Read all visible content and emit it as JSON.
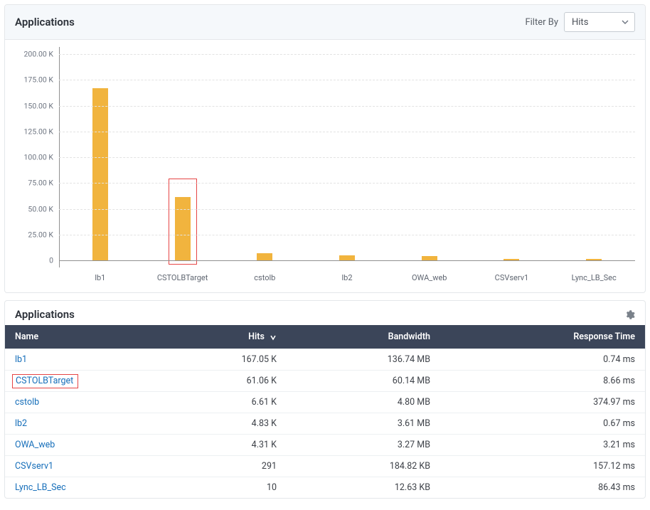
{
  "chart_panel": {
    "title": "Applications",
    "filter_label": "Filter By",
    "filter_value": "Hits"
  },
  "chart_data": {
    "type": "bar",
    "title": "",
    "xlabel": "",
    "ylabel": "",
    "categories": [
      "lb1",
      "CSTOLBTarget",
      "cstolb",
      "lb2",
      "OWA_web",
      "CSVserv1",
      "Lync_LB_Sec"
    ],
    "values": [
      167050,
      61060,
      6610,
      4830,
      4310,
      291,
      10
    ],
    "ylim": [
      0,
      200000
    ],
    "y_ticks": [
      0,
      25000,
      50000,
      75000,
      100000,
      125000,
      150000,
      175000,
      200000
    ],
    "y_tick_labels": [
      "0",
      "25.00 K",
      "50.00 K",
      "75.00 K",
      "100.00 K",
      "125.00 K",
      "150.00 K",
      "175.00 K",
      "200.00 K"
    ],
    "highlighted_category": "CSTOLBTarget",
    "bar_color": "#f1b43e"
  },
  "table_panel": {
    "title": "Applications",
    "columns": {
      "name": "Name",
      "hits": "Hits",
      "bandwidth": "Bandwidth",
      "response_time": "Response Time"
    },
    "sort_column": "hits",
    "sort_dir_icon": "down",
    "highlighted_row_name": "CSTOLBTarget",
    "rows": [
      {
        "name": "lb1",
        "hits": "167.05 K",
        "bandwidth": "136.74 MB",
        "response_time": "0.74 ms"
      },
      {
        "name": "CSTOLBTarget",
        "hits": "61.06 K",
        "bandwidth": "60.14 MB",
        "response_time": "8.66 ms"
      },
      {
        "name": "cstolb",
        "hits": "6.61 K",
        "bandwidth": "4.80 MB",
        "response_time": "374.97 ms"
      },
      {
        "name": "lb2",
        "hits": "4.83 K",
        "bandwidth": "3.61 MB",
        "response_time": "0.67 ms"
      },
      {
        "name": "OWA_web",
        "hits": "4.31 K",
        "bandwidth": "3.27 MB",
        "response_time": "3.21 ms"
      },
      {
        "name": "CSVserv1",
        "hits": "291",
        "bandwidth": "184.82 KB",
        "response_time": "157.12 ms"
      },
      {
        "name": "Lync_LB_Sec",
        "hits": "10",
        "bandwidth": "12.63 KB",
        "response_time": "86.43 ms"
      }
    ]
  }
}
